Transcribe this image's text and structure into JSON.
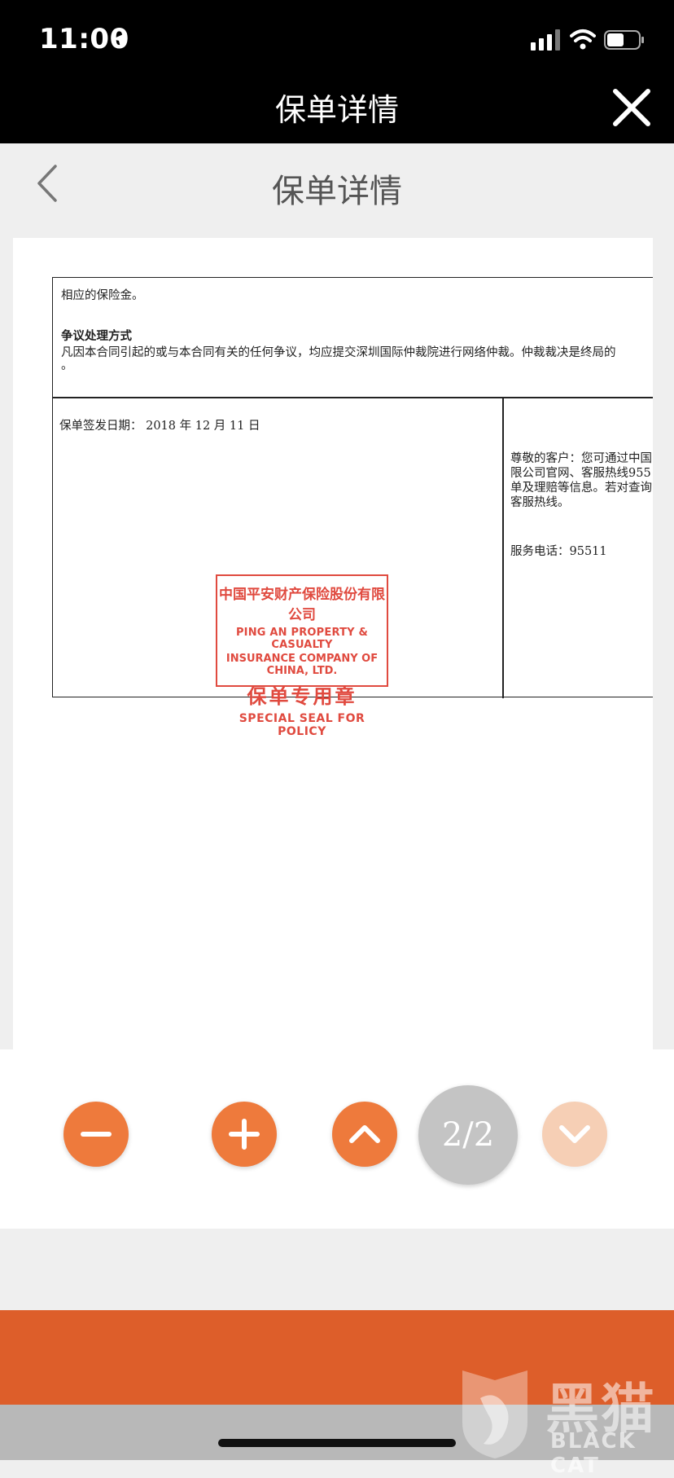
{
  "status_bar": {
    "time": "11:00"
  },
  "nav": {
    "title": "保单详情"
  },
  "subheader": {
    "title": "保单详情"
  },
  "document": {
    "line1": "相应的保险金。",
    "section_heading": "争议处理方式",
    "dispute_text": "凡因本合同引起的或与本合同有关的任何争议，均应提交深圳国际仲裁院进行网络仲裁。仲裁裁决是终局的",
    "dispute_tail": "。",
    "issue_date": "保单签发日期：  2018  年  12  月  11  日",
    "notice_lines": [
      "尊敬的客户：您可通过中国",
      "限公司官网、客服热线955",
      "单及理赔等信息。若对查询",
      "客服热线。"
    ],
    "service_phone": "服务电话：95511",
    "seal": {
      "line_cn": "中国平安财产保险股份有限公司",
      "line_en1": "PING AN PROPERTY & CASUALTY",
      "line_en2": "INSURANCE COMPANY OF CHINA, LTD.",
      "title_cn": "保单专用章",
      "title_en": "SPECIAL SEAL FOR POLICY"
    }
  },
  "controls": {
    "page_indicator": "2/2"
  },
  "watermark": {
    "cn": "黑猫",
    "en": "BLACK CAT"
  },
  "colors": {
    "accent": "#ee7a3c",
    "accent_disabled": "#f6cfb5",
    "band": "#dd5e2a",
    "seal": "#e04a3f"
  }
}
